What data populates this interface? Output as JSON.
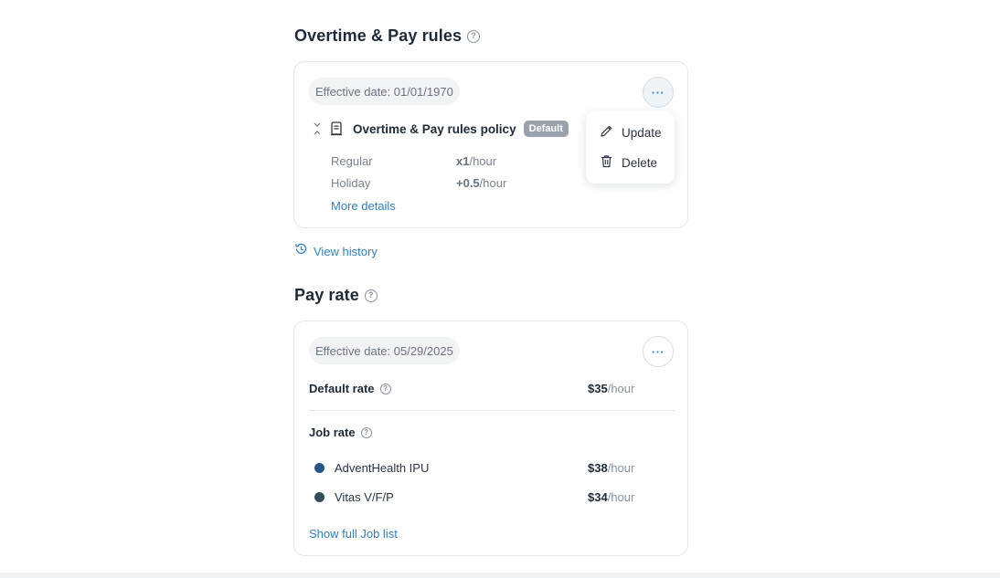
{
  "overtime": {
    "title": "Overtime & Pay rules",
    "effective_date": "Effective date: 01/01/1970",
    "more_icon": "ellipsis-icon",
    "policy_name": "Overtime & Pay rules policy",
    "badge": "Default",
    "rows": [
      {
        "label": "Regular",
        "value": "x1",
        "unit": "/hour"
      },
      {
        "label": "Holiday",
        "value": "+0.5",
        "unit": "/hour"
      }
    ],
    "more_details": "More details",
    "menu": {
      "update": "Update",
      "delete": "Delete"
    },
    "view_history": "View history"
  },
  "pay_rate": {
    "title": "Pay rate",
    "effective_date": "Effective date: 05/29/2025",
    "default_rate_label": "Default rate",
    "default_rate_value": "$35",
    "unit": "/hour",
    "job_rate_label": "Job rate",
    "jobs": [
      {
        "name": "AdventHealth IPU",
        "rate": "$38",
        "unit": "/hour",
        "color": "#245786"
      },
      {
        "name": "Vitas V/F/P",
        "rate": "$34",
        "unit": "/hour",
        "color": "#344d5e"
      }
    ],
    "show_full": "Show full Job list"
  },
  "colors": {
    "accent": "#2f7fc8",
    "badge": "#9aa3ad"
  }
}
